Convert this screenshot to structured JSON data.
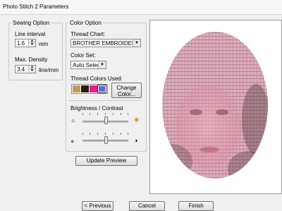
{
  "window": {
    "title": "Photo Stitch 2 Parameters"
  },
  "sewing": {
    "legend": "Sewing Option",
    "line_interval_label": "Line interval",
    "line_interval_value": "1.6",
    "line_interval_unit": "mm",
    "max_density_label": "Max. Density",
    "max_density_value": "3.4",
    "max_density_unit": "line/mm"
  },
  "color": {
    "legend": "Color Option",
    "thread_chart_label": "Thread Chart:",
    "thread_chart_value": "BROTHER EMBROIDERY",
    "color_set_label": "Color Set:",
    "color_set_value": "Auto Select",
    "thread_colors_label": "Thread Colors Used:",
    "swatches": [
      "#c49a55",
      "#2a1c14",
      "#e61e8c",
      "#5b6fd6"
    ],
    "change_color_label_1": "Change",
    "change_color_label_2": "Color...",
    "brightness_label": "Brightness / Contrast",
    "brightness_level": 0.5,
    "contrast_level": 0.5
  },
  "buttons": {
    "update_preview": "Update Preview",
    "previous": "< Previous",
    "cancel": "Cancel",
    "finish": "Finish"
  }
}
